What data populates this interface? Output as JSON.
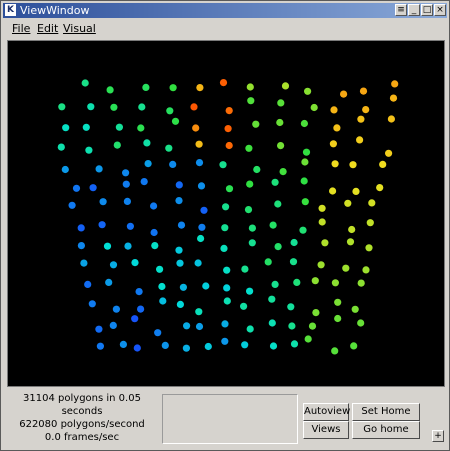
{
  "window": {
    "title": "ViewWindow",
    "icon_letter": "K"
  },
  "titlebar_buttons": [
    "≡",
    "_",
    "□",
    "×"
  ],
  "menu": [
    {
      "label": "File"
    },
    {
      "label": "Edit"
    },
    {
      "label": "Visual"
    }
  ],
  "stats": {
    "polygons": "31104 polygons in 0.05 seconds",
    "rate": "622080 polygons/second",
    "fps": "0.0 frames/sec"
  },
  "buttons": {
    "autoview": "Autoview",
    "set_home_view": "Set Home View",
    "views": "Views",
    "go_home": "Go home",
    "corner": "+"
  },
  "colormap": [
    "#1a3cff",
    "#00e0d8",
    "#30e040",
    "#f0e020",
    "#ff5000"
  ]
}
